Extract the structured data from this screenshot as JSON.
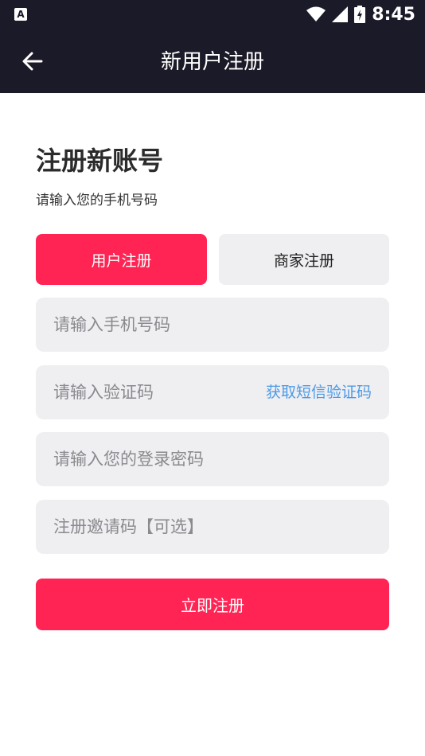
{
  "status_bar": {
    "time": "8:45",
    "app_badge": "A",
    "icons": [
      "wifi-icon",
      "signal-icon",
      "battery-charging-icon"
    ]
  },
  "app_bar": {
    "title": "新用户注册",
    "back_icon": "arrow-left-icon"
  },
  "form": {
    "heading": "注册新账号",
    "subheading": "请输入您的手机号码",
    "tabs": [
      {
        "label": "用户注册",
        "active": true
      },
      {
        "label": "商家注册",
        "active": false
      }
    ],
    "fields": {
      "phone": {
        "value": "",
        "placeholder": "请输入手机号码"
      },
      "code": {
        "value": "",
        "placeholder": "请输入验证码",
        "action_label": "获取短信验证码"
      },
      "password": {
        "value": "",
        "placeholder": "请输入您的登录密码"
      },
      "invite": {
        "value": "",
        "placeholder": "注册邀请码【可选】"
      }
    },
    "submit_label": "立即注册"
  },
  "colors": {
    "header_bg": "#1b1a28",
    "accent": "#ff2454",
    "field_bg": "#efeef0",
    "link": "#4b9be8"
  }
}
